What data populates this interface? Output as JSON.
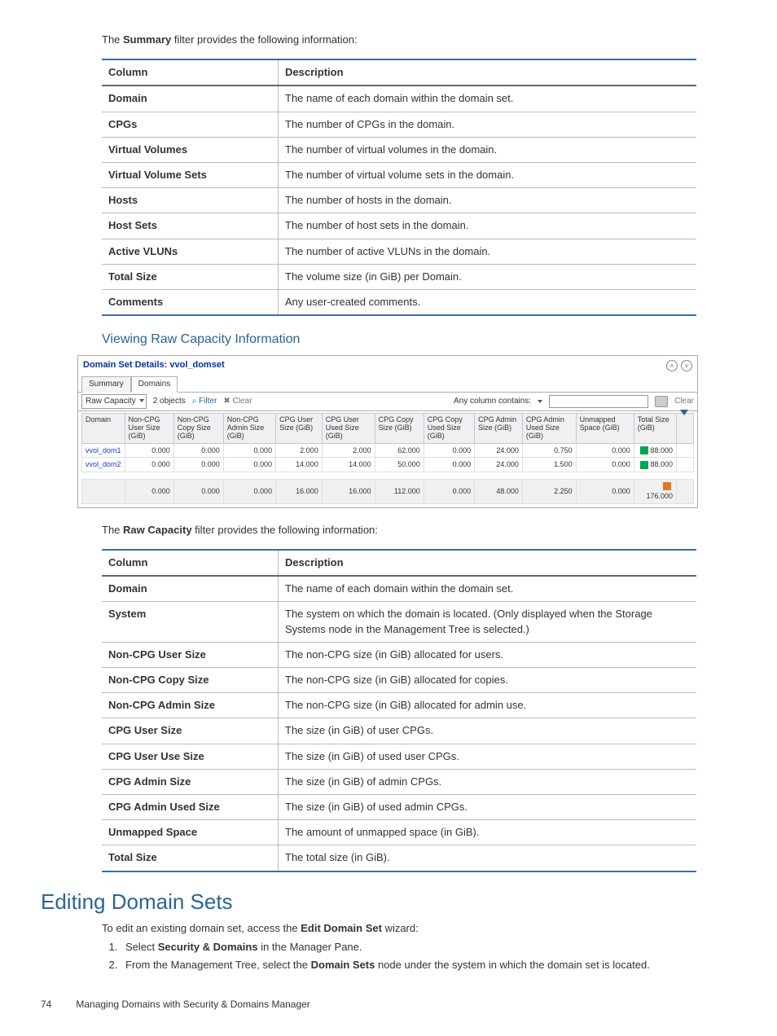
{
  "intro_summary_prefix": "The ",
  "intro_summary_bold": "Summary",
  "intro_summary_suffix": " filter provides the following information:",
  "summary_table": {
    "head": {
      "c1": "Column",
      "c2": "Description"
    },
    "rows": [
      {
        "c1": "Domain",
        "c2": "The name of each domain within the domain set."
      },
      {
        "c1": "CPGs",
        "c2": "The number of CPGs in the domain."
      },
      {
        "c1": "Virtual Volumes",
        "c2": "The number of virtual volumes in the domain."
      },
      {
        "c1": "Virtual Volume Sets",
        "c2": "The number of virtual volume sets in the domain."
      },
      {
        "c1": "Hosts",
        "c2": "The number of hosts in the domain."
      },
      {
        "c1": "Host Sets",
        "c2": "The number of host sets in the domain."
      },
      {
        "c1": "Active VLUNs",
        "c2": "The number of active VLUNs in the domain."
      },
      {
        "c1": "Total Size",
        "c2": "The volume size (in GiB) per Domain."
      },
      {
        "c1": "Comments",
        "c2": "Any user-created comments."
      }
    ]
  },
  "subheading_raw": "Viewing Raw Capacity Information",
  "ui": {
    "title": "Domain Set Details: vvol_domset",
    "tabs": {
      "summary": "Summary",
      "domains": "Domains"
    },
    "toolbar": {
      "dropdown": "Raw Capacity",
      "objects": "2 objects",
      "filter": "Filter",
      "clear": "Clear",
      "contains": "Any column contains:",
      "right_clear": "Clear"
    },
    "columns": {
      "domain": "Domain",
      "non_cpg_user": "Non-CPG User Size (GiB)",
      "non_cpg_copy": "Non-CPG Copy Size (GiB)",
      "non_cpg_admin": "Non-CPG Admin Size (GiB)",
      "cpg_user_size": "CPG User Size (GiB)",
      "cpg_user_used": "CPG User Used Size (GiB)",
      "cpg_copy_size": "CPG Copy Size (GiB)",
      "cpg_copy_used": "CPG Copy Used Size (GiB)",
      "cpg_admin_size": "CPG Admin Size (GiB)",
      "cpg_admin_used": "CPG Admin Used Size (GiB)",
      "unmapped": "Unmapped Space (GiB)",
      "total": "Total Size (GiB)"
    },
    "rows": [
      {
        "domain": "vvol_dom1",
        "v": [
          "0.000",
          "0.000",
          "0.000",
          "2.000",
          "2.000",
          "62.000",
          "0.000",
          "24.000",
          "0.750",
          "0.000",
          "88.000"
        ]
      },
      {
        "domain": "vvol_dom2",
        "v": [
          "0.000",
          "0.000",
          "0.000",
          "14.000",
          "14.000",
          "50.000",
          "0.000",
          "24.000",
          "1.500",
          "0.000",
          "88.000"
        ]
      }
    ],
    "totals": [
      "0.000",
      "0.000",
      "0.000",
      "16.000",
      "16.000",
      "112.000",
      "0.000",
      "48.000",
      "2.250",
      "0.000",
      "176.000"
    ]
  },
  "intro_raw_prefix": "The ",
  "intro_raw_bold": "Raw Capacity",
  "intro_raw_suffix": " filter provides the following information:",
  "raw_table": {
    "head": {
      "c1": "Column",
      "c2": "Description"
    },
    "rows": [
      {
        "c1": "Domain",
        "c2": "The name of each domain within the domain set."
      },
      {
        "c1": "System",
        "c2": "The system on which the domain is located. (Only displayed when the Storage Systems node in the Management Tree is selected.)"
      },
      {
        "c1": "Non-CPG User Size",
        "c2": "The non-CPG size (in GiB) allocated for users."
      },
      {
        "c1": "Non-CPG Copy Size",
        "c2": "The non-CPG size (in GiB) allocated for copies."
      },
      {
        "c1": "Non-CPG Admin Size",
        "c2": "The non-CPG size (in GiB) allocated for admin use."
      },
      {
        "c1": "CPG User Size",
        "c2": "The size (in GiB) of user CPGs."
      },
      {
        "c1": "CPG User Use Size",
        "c2": "The size (in GiB) of used user CPGs."
      },
      {
        "c1": "CPG Admin Size",
        "c2": "The size (in GiB) of admin CPGs."
      },
      {
        "c1": "CPG Admin Used Size",
        "c2": "The size (in GiB) of used admin CPGs."
      },
      {
        "c1": "Unmapped Space",
        "c2": "The amount of unmapped space (in GiB)."
      },
      {
        "c1": "Total Size",
        "c2": "The total size (in GiB)."
      }
    ]
  },
  "h2_edit": "Editing Domain Sets",
  "edit_intro_prefix": "To edit an existing domain set, access the ",
  "edit_intro_bold": "Edit Domain Set",
  "edit_intro_suffix": " wizard:",
  "steps": {
    "s1_prefix": "Select ",
    "s1_bold": "Security & Domains",
    "s1_suffix": " in the Manager Pane.",
    "s2_prefix": "From the Management Tree, select the ",
    "s2_bold": "Domain Sets",
    "s2_suffix": " node under the system in which the domain set is located."
  },
  "footer": {
    "page": "74",
    "title": "Managing Domains with Security & Domains Manager"
  }
}
